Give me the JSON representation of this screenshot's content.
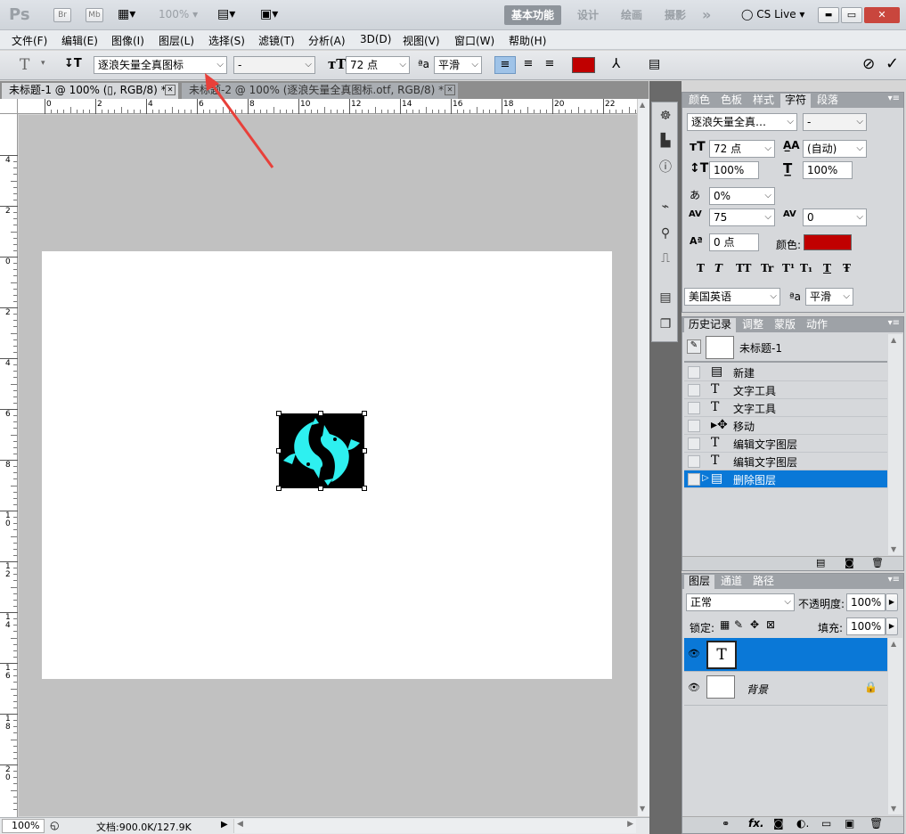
{
  "app": {
    "logo": "Ps",
    "br": "Br",
    "mb": "Mb",
    "zoom": "100%"
  },
  "workspace": {
    "active": "基本功能",
    "items": [
      "设计",
      "绘画",
      "摄影"
    ],
    "more": "»",
    "cs_live": "CS Live"
  },
  "window_buttons": {
    "min": "▬",
    "max": "▭",
    "close": "✕"
  },
  "menu": [
    "文件(F)",
    "编辑(E)",
    "图像(I)",
    "图层(L)",
    "选择(S)",
    "滤镜(T)",
    "分析(A)",
    "3D(D)",
    "视图(V)",
    "窗口(W)",
    "帮助(H)"
  ],
  "options": {
    "font_family": "逐浪矢量全真图标",
    "font_style": "-",
    "font_size": "72 点",
    "antialias": "平滑",
    "text_color": "#c00000"
  },
  "tabs": [
    {
      "label": "未标题-1 @ 100% (▯, RGB/8) *"
    },
    {
      "label": "未标题-2 @ 100% (逐浪矢量全真图标.otf, RGB/8) *"
    }
  ],
  "rulers": {
    "h": [
      "0",
      "2",
      "4",
      "6",
      "8",
      "10",
      "12",
      "14",
      "16",
      "18",
      "20",
      "22"
    ],
    "v": [
      "4",
      "2",
      "0",
      "2",
      "4",
      "6",
      "8",
      "10",
      "12",
      "14",
      "16",
      "18",
      "20"
    ]
  },
  "status": {
    "zoom": "100%",
    "doc": "文档:900.0K/127.9K"
  },
  "char_panel": {
    "tabs": [
      "颜色",
      "色板",
      "样式",
      "字符",
      "段落"
    ],
    "active_tab": "字符",
    "font": "逐浪矢量全真…",
    "style": "-",
    "size": "72 点",
    "leading": "(自动)",
    "vscale": "100%",
    "hscale": "100%",
    "tracking_pct": "0%",
    "kerning": "75",
    "tracking": "0",
    "baseline": "0 点",
    "color_label": "颜色:",
    "color": "#c00000",
    "lang": "美国英语",
    "aa_label": "平滑",
    "styles": [
      "T",
      "T",
      "TT",
      "Tr",
      "T¹",
      "T₁",
      "T",
      "Ŧ"
    ]
  },
  "history_panel": {
    "tabs": [
      "历史记录",
      "调整",
      "蒙版",
      "动作"
    ],
    "active_tab": "历史记录",
    "snapshot": "未标题-1",
    "items": [
      "新建",
      "文字工具",
      "文字工具",
      "移动",
      "编辑文字图层",
      "编辑文字图层",
      "删除图层"
    ]
  },
  "layers_panel": {
    "tabs": [
      "图层",
      "通道",
      "路径"
    ],
    "active_tab": "图层",
    "blend": "正常",
    "opacity_label": "不透明度:",
    "opacity": "100%",
    "lock_label": "锁定:",
    "fill_label": "填充:",
    "fill": "100%",
    "layers": [
      {
        "name": "",
        "type": "T",
        "selected": true
      },
      {
        "name": "背景",
        "type": "bg",
        "selected": false
      }
    ]
  },
  "colors": {
    "accent": "#0a78d7",
    "brand": "#00ffff"
  }
}
